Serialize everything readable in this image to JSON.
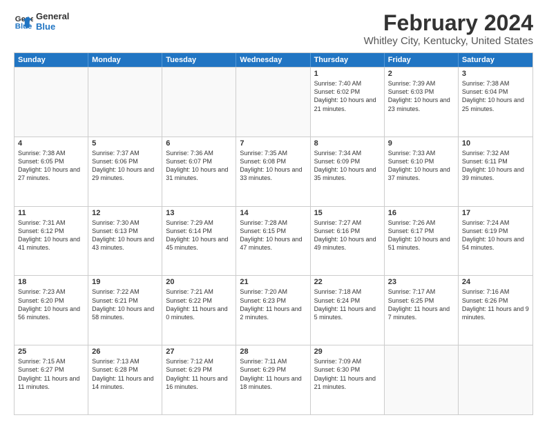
{
  "logo": {
    "line1": "General",
    "line2": "Blue"
  },
  "title": "February 2024",
  "subtitle": "Whitley City, Kentucky, United States",
  "days_of_week": [
    "Sunday",
    "Monday",
    "Tuesday",
    "Wednesday",
    "Thursday",
    "Friday",
    "Saturday"
  ],
  "weeks": [
    [
      {
        "day": "",
        "info": ""
      },
      {
        "day": "",
        "info": ""
      },
      {
        "day": "",
        "info": ""
      },
      {
        "day": "",
        "info": ""
      },
      {
        "day": "1",
        "info": "Sunrise: 7:40 AM\nSunset: 6:02 PM\nDaylight: 10 hours and 21 minutes."
      },
      {
        "day": "2",
        "info": "Sunrise: 7:39 AM\nSunset: 6:03 PM\nDaylight: 10 hours and 23 minutes."
      },
      {
        "day": "3",
        "info": "Sunrise: 7:38 AM\nSunset: 6:04 PM\nDaylight: 10 hours and 25 minutes."
      }
    ],
    [
      {
        "day": "4",
        "info": "Sunrise: 7:38 AM\nSunset: 6:05 PM\nDaylight: 10 hours and 27 minutes."
      },
      {
        "day": "5",
        "info": "Sunrise: 7:37 AM\nSunset: 6:06 PM\nDaylight: 10 hours and 29 minutes."
      },
      {
        "day": "6",
        "info": "Sunrise: 7:36 AM\nSunset: 6:07 PM\nDaylight: 10 hours and 31 minutes."
      },
      {
        "day": "7",
        "info": "Sunrise: 7:35 AM\nSunset: 6:08 PM\nDaylight: 10 hours and 33 minutes."
      },
      {
        "day": "8",
        "info": "Sunrise: 7:34 AM\nSunset: 6:09 PM\nDaylight: 10 hours and 35 minutes."
      },
      {
        "day": "9",
        "info": "Sunrise: 7:33 AM\nSunset: 6:10 PM\nDaylight: 10 hours and 37 minutes."
      },
      {
        "day": "10",
        "info": "Sunrise: 7:32 AM\nSunset: 6:11 PM\nDaylight: 10 hours and 39 minutes."
      }
    ],
    [
      {
        "day": "11",
        "info": "Sunrise: 7:31 AM\nSunset: 6:12 PM\nDaylight: 10 hours and 41 minutes."
      },
      {
        "day": "12",
        "info": "Sunrise: 7:30 AM\nSunset: 6:13 PM\nDaylight: 10 hours and 43 minutes."
      },
      {
        "day": "13",
        "info": "Sunrise: 7:29 AM\nSunset: 6:14 PM\nDaylight: 10 hours and 45 minutes."
      },
      {
        "day": "14",
        "info": "Sunrise: 7:28 AM\nSunset: 6:15 PM\nDaylight: 10 hours and 47 minutes."
      },
      {
        "day": "15",
        "info": "Sunrise: 7:27 AM\nSunset: 6:16 PM\nDaylight: 10 hours and 49 minutes."
      },
      {
        "day": "16",
        "info": "Sunrise: 7:26 AM\nSunset: 6:17 PM\nDaylight: 10 hours and 51 minutes."
      },
      {
        "day": "17",
        "info": "Sunrise: 7:24 AM\nSunset: 6:19 PM\nDaylight: 10 hours and 54 minutes."
      }
    ],
    [
      {
        "day": "18",
        "info": "Sunrise: 7:23 AM\nSunset: 6:20 PM\nDaylight: 10 hours and 56 minutes."
      },
      {
        "day": "19",
        "info": "Sunrise: 7:22 AM\nSunset: 6:21 PM\nDaylight: 10 hours and 58 minutes."
      },
      {
        "day": "20",
        "info": "Sunrise: 7:21 AM\nSunset: 6:22 PM\nDaylight: 11 hours and 0 minutes."
      },
      {
        "day": "21",
        "info": "Sunrise: 7:20 AM\nSunset: 6:23 PM\nDaylight: 11 hours and 2 minutes."
      },
      {
        "day": "22",
        "info": "Sunrise: 7:18 AM\nSunset: 6:24 PM\nDaylight: 11 hours and 5 minutes."
      },
      {
        "day": "23",
        "info": "Sunrise: 7:17 AM\nSunset: 6:25 PM\nDaylight: 11 hours and 7 minutes."
      },
      {
        "day": "24",
        "info": "Sunrise: 7:16 AM\nSunset: 6:26 PM\nDaylight: 11 hours and 9 minutes."
      }
    ],
    [
      {
        "day": "25",
        "info": "Sunrise: 7:15 AM\nSunset: 6:27 PM\nDaylight: 11 hours and 11 minutes."
      },
      {
        "day": "26",
        "info": "Sunrise: 7:13 AM\nSunset: 6:28 PM\nDaylight: 11 hours and 14 minutes."
      },
      {
        "day": "27",
        "info": "Sunrise: 7:12 AM\nSunset: 6:29 PM\nDaylight: 11 hours and 16 minutes."
      },
      {
        "day": "28",
        "info": "Sunrise: 7:11 AM\nSunset: 6:29 PM\nDaylight: 11 hours and 18 minutes."
      },
      {
        "day": "29",
        "info": "Sunrise: 7:09 AM\nSunset: 6:30 PM\nDaylight: 11 hours and 21 minutes."
      },
      {
        "day": "",
        "info": ""
      },
      {
        "day": "",
        "info": ""
      }
    ]
  ]
}
